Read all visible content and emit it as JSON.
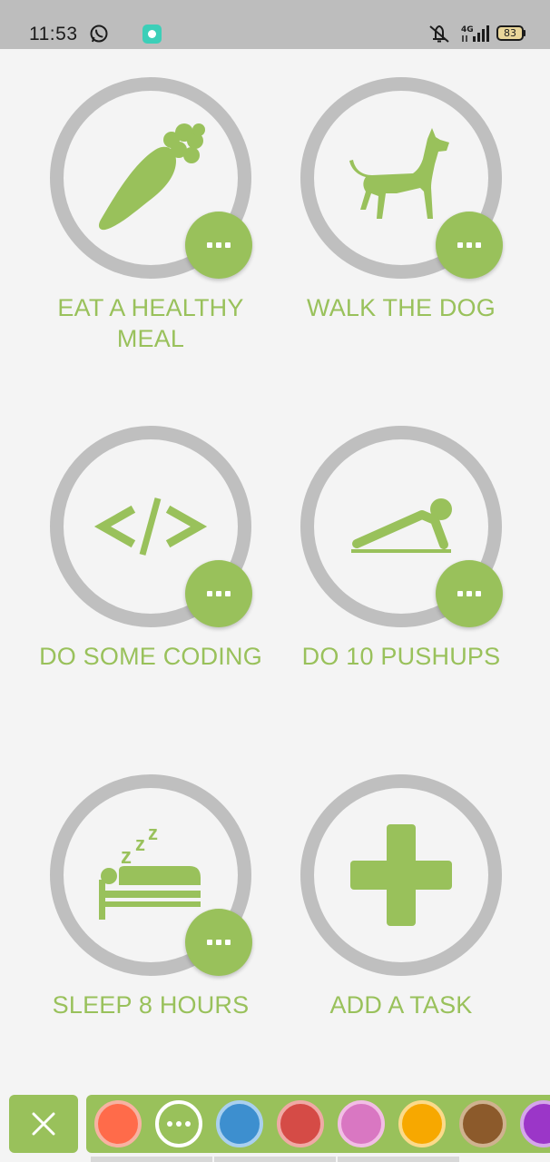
{
  "status_bar": {
    "time": "11:53",
    "network": "4G",
    "battery": "83",
    "icons": [
      "whatsapp-icon",
      "app-notification-icon",
      "mute-icon",
      "signal-icon",
      "battery-icon"
    ]
  },
  "tasks": [
    {
      "label": "EAT A HEALTHY MEAL",
      "icon": "carrot-icon",
      "menu": "more-icon"
    },
    {
      "label": "WALK THE DOG",
      "icon": "dog-icon",
      "menu": "more-icon"
    },
    {
      "label": "DO SOME CODING",
      "icon": "code-icon",
      "menu": "more-icon"
    },
    {
      "label": "DO 10 PUSHUPS",
      "icon": "pushup-icon",
      "menu": "more-icon"
    },
    {
      "label": "SLEEP 8 HOURS",
      "icon": "sleep-icon",
      "menu": "more-icon"
    },
    {
      "label": "ADD A TASK",
      "icon": "plus-icon"
    }
  ],
  "palette": {
    "close_icon": "close-icon",
    "swatches": [
      "#ff6b4a",
      "selected",
      "#3d8fcf",
      "#d54b46",
      "#d977c2",
      "#f7a800",
      "#8c5a2b",
      "#9b36c8"
    ]
  },
  "colors": {
    "accent": "#99c15b",
    "ring": "#bfbfbf",
    "background": "#f4f4f4",
    "status_bar": "#bdbdbd"
  }
}
